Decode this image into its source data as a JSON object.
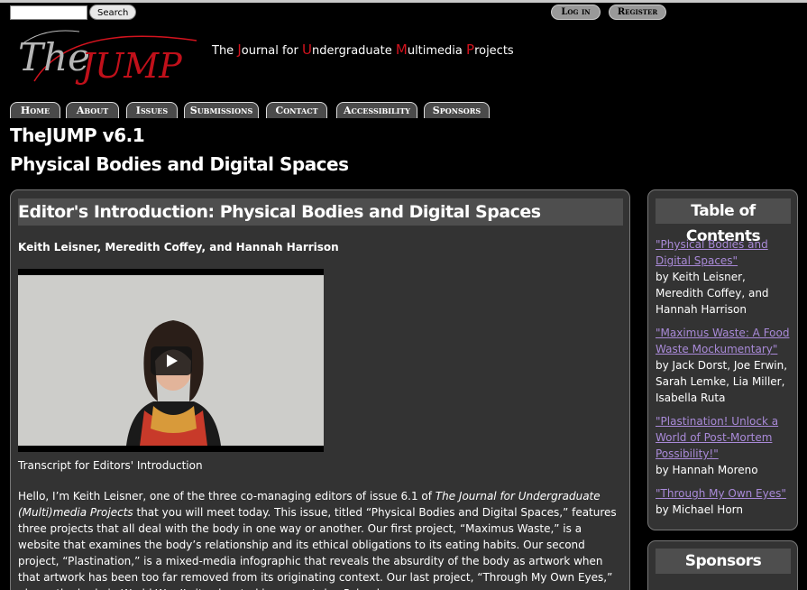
{
  "search": {
    "placeholder": "",
    "button": "Search"
  },
  "auth": {
    "login": "Log in",
    "register": "Register"
  },
  "logo": {
    "text_the": "The",
    "text_jump": "JUMP"
  },
  "tagline": {
    "parts": [
      {
        "t": "The ",
        "red": false
      },
      {
        "t": "J",
        "red": true
      },
      {
        "t": "ournal for ",
        "red": false
      },
      {
        "t": "U",
        "red": true
      },
      {
        "t": "ndergraduate ",
        "red": false
      },
      {
        "t": "M",
        "red": true
      },
      {
        "t": "ultimedia ",
        "red": false
      },
      {
        "t": "P",
        "red": true
      },
      {
        "t": "rojects",
        "red": false
      }
    ]
  },
  "nav": [
    "Home",
    "About",
    "Issues",
    "Submissions",
    "Contact",
    "Accessibility",
    "Sponsors"
  ],
  "issue": {
    "title": "TheJUMP v6.1",
    "subtitle": "Physical Bodies and Digital Spaces"
  },
  "article": {
    "heading": "Editor's Introduction: Physical Bodies and Digital Spaces",
    "authors": "Keith Leisner, Meredith Coffey, and Hannah Harrison",
    "transcript_label": "Transcript for Editors' Introduction",
    "body_1": "Hello, I’m Keith Leisner, one of the three co-managing editors of issue 6.1 of ",
    "body_journal": "The Journal for Undergraduate (Multi)media Projects",
    "body_2": " that you will meet today. This issue, titled “Physical Bodies and Digital Spaces,” features three projects that all deal with the body in one way or another. Our first project, “Maximus Waste,” is a website that examines the body’s relationship and its ethical obligations to its eating habits. Our second project, “Plastination,” is a mixed-media infographic that reveals the absurdity of the body as artwork when that artwork has been too far removed from its originating context. Our last project, “Through My Own Eyes,” places the body in World War II sites located in present-day Poland."
  },
  "toc": {
    "heading": "Table of Contents",
    "items": [
      {
        "link": "\"Physical Bodies and Digital Spaces\"",
        "by": "by Keith Leisner, Meredith Coffey, and Hannah Harrison"
      },
      {
        "link": "\"Maximus Waste: A Food Waste Mockumentary\"",
        "by": "by Jack Dorst, Joe Erwin, Sarah Lemke, Lia Miller, Isabella Ruta"
      },
      {
        "link": "\"Plastination! Unlock a World of Post-Mortem Possibility!\"",
        "by": "by Hannah Moreno"
      },
      {
        "link": "\"Through My Own Eyes\"",
        "by": "by Michael Horn"
      }
    ]
  },
  "sponsors": {
    "heading": "Sponsors"
  },
  "colors": {
    "accent_red": "#d3131e",
    "link_purple": "#a98ad8",
    "panel": "#333333"
  }
}
